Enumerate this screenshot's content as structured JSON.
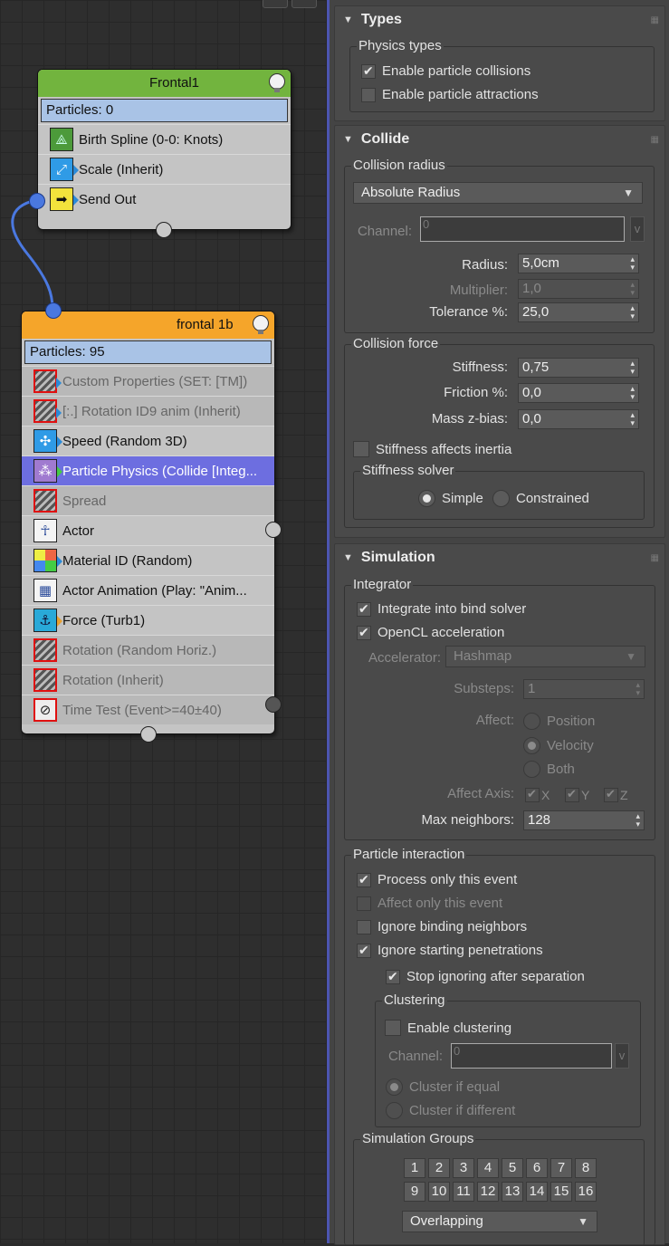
{
  "node1": {
    "title": "Frontal1",
    "particles": "Particles: 0",
    "operators": [
      "Birth Spline (0-0: Knots)",
      "Scale (Inherit)",
      "Send Out"
    ]
  },
  "node2": {
    "title": "frontal 1b",
    "particles": "Particles: 95",
    "operators": [
      "Custom Properties (SET: [TM])",
      "[:.] Rotation ID9 anim (Inherit)",
      "Speed (Random 3D)",
      "Particle Physics (Collide [Integ...",
      "Spread",
      "Actor",
      "Material ID (Random)",
      "Actor Animation (Play: \"Anim...",
      "Force (Turb1)",
      "Rotation (Random Horiz.)",
      "Rotation (Inherit)",
      "Time Test (Event>=40±40)"
    ]
  },
  "types": {
    "title": "Types",
    "group": "Physics types",
    "collisions": "Enable particle collisions",
    "attractions": "Enable particle attractions"
  },
  "collide": {
    "title": "Collide",
    "radius_group": "Collision radius",
    "radius_mode": "Absolute Radius",
    "channel_label": "Channel:",
    "channel_value": "0",
    "v": "v",
    "radius_label": "Radius:",
    "radius_value": "5,0cm",
    "multiplier_label": "Multiplier:",
    "multiplier_value": "1,0",
    "tolerance_label": "Tolerance %:",
    "tolerance_value": "25,0",
    "force_group": "Collision force",
    "stiffness_label": "Stiffness:",
    "stiffness_value": "0,75",
    "friction_label": "Friction %:",
    "friction_value": "0,0",
    "massz_label": "Mass z-bias:",
    "massz_value": "0,0",
    "stiff_inertia": "Stiffness affects inertia",
    "solver_group": "Stiffness solver",
    "simple": "Simple",
    "constrained": "Constrained"
  },
  "simulation": {
    "title": "Simulation",
    "integrator_group": "Integrator",
    "bind_solver": "Integrate into bind solver",
    "opencl": "OpenCL acceleration",
    "accel_label": "Accelerator:",
    "accel_value": "Hashmap",
    "substeps_label": "Substeps:",
    "substeps_value": "1",
    "affect_label": "Affect:",
    "position": "Position",
    "velocity": "Velocity",
    "both": "Both",
    "axis_label": "Affect Axis:",
    "axis_x": "X",
    "axis_y": "Y",
    "axis_z": "Z",
    "maxn_label": "Max neighbors:",
    "maxn_value": "128",
    "interaction_group": "Particle interaction",
    "process_only": "Process only this event",
    "affect_only": "Affect only this event",
    "ignore_binding": "Ignore binding neighbors",
    "ignore_starting": "Ignore starting penetrations",
    "stop_ignoring": "Stop ignoring after separation",
    "clustering_group": "Clustering",
    "enable_clustering": "Enable clustering",
    "channel_label": "Channel:",
    "channel_value": "0",
    "v": "v",
    "cluster_equal": "Cluster if equal",
    "cluster_diff": "Cluster if different",
    "groups_group": "Simulation Groups",
    "groups": [
      "1",
      "2",
      "3",
      "4",
      "5",
      "6",
      "7",
      "8",
      "9",
      "10",
      "11",
      "12",
      "13",
      "14",
      "15",
      "16"
    ],
    "overlap": "Overlapping"
  },
  "colors": {
    "node1_header": "#72b43e",
    "node2_header": "#f5a52a",
    "selected_row": "#6d6ee0",
    "wire": "#4a78e0"
  }
}
